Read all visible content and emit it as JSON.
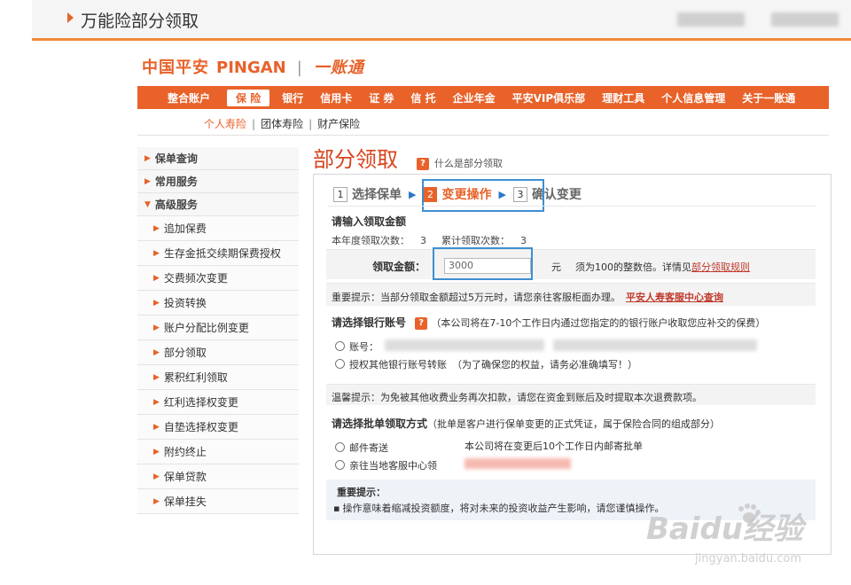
{
  "header": {
    "title": "万能险部分领取"
  },
  "logo": {
    "cn": "中国平安",
    "en": "PINGAN",
    "sub": "一账通"
  },
  "nav": {
    "items": [
      "整合账户",
      "保 险",
      "银行",
      "信用卡",
      "证 券",
      "信 托",
      "企业年金",
      "平安VIP俱乐部",
      "理财工具",
      "个人信息管理",
      "关于一账通"
    ],
    "active_index": 1
  },
  "subnav": {
    "items": [
      "个人寿险",
      "团体寿险",
      "财产保险"
    ]
  },
  "sidebar": {
    "items": [
      {
        "label": "保单查询",
        "level": 1
      },
      {
        "label": "常用服务",
        "level": 1
      },
      {
        "label": "高级服务",
        "level": 1,
        "open": true
      },
      {
        "label": "追加保费",
        "level": 2
      },
      {
        "label": "生存金抵交续期保费授权",
        "level": 2
      },
      {
        "label": "交费频次变更",
        "level": 2
      },
      {
        "label": "投资转换",
        "level": 2
      },
      {
        "label": "账户分配比例变更",
        "level": 2
      },
      {
        "label": "部分领取",
        "level": 2
      },
      {
        "label": "累积红利领取",
        "level": 2
      },
      {
        "label": "红利选择权变更",
        "level": 2
      },
      {
        "label": "自垫选择权变更",
        "level": 2
      },
      {
        "label": "附约终止",
        "level": 2
      },
      {
        "label": "保单贷款",
        "level": 2
      },
      {
        "label": "保单挂失",
        "level": 2
      }
    ]
  },
  "main": {
    "title": "部分领取",
    "what_is": "什么是部分领取",
    "steps": [
      {
        "num": "1",
        "label": "选择保单"
      },
      {
        "num": "2",
        "label": "变更操作"
      },
      {
        "num": "3",
        "label": "确认变更"
      }
    ],
    "amount_section": {
      "title": "请输入领取金额",
      "year_count_label": "本年度领取次数：",
      "year_count": "3",
      "total_count_label": "累计领取次数：",
      "total_count": "3",
      "amount_label": "领取金额：",
      "amount_value": "3000",
      "unit": "元",
      "hint": "须为100的整数倍。详情见",
      "rule_link": "部分领取规则"
    },
    "important_tip": "重要提示：当部分领取金额超过5万元时，请您亲往客服柜面办理。",
    "service_link": "平安人寿客服中心查询",
    "bank_section": {
      "title": "请选择银行账号",
      "note": "（本公司将在7-10个工作日内通过您指定的的银行账户收取您应补交的保费）",
      "option_account": "账号：",
      "option_other": "授权其他银行账号转账",
      "option_other_note": "（为了确保您的权益，请务必准确填写！）"
    },
    "warm_tip": "温馨提示：为免被其他收费业务再次扣款，请您在资金到账后及时提取本次退费款项。",
    "batch_section": {
      "title": "请选择批单领取方式",
      "note": "（批单是客户进行保单变更的正式凭证，属于保险合同的组成部分）",
      "option_mail": "邮件寄送",
      "mail_desc": "本公司将在变更后10个工作日内邮寄批单",
      "option_local": "亲往当地客服中心领"
    },
    "final_notice": {
      "title": "重要提示：",
      "text": "操作意味着缩减投资额度，将对未来的投资收益产生影响，请您谨慎操作。"
    }
  },
  "watermark": {
    "main": "Baidu经验",
    "sub": "jingyan.baidu.com"
  },
  "colors": {
    "accent": "#e8622a",
    "highlight": "#3d8fd3",
    "link": "#c0392b"
  }
}
